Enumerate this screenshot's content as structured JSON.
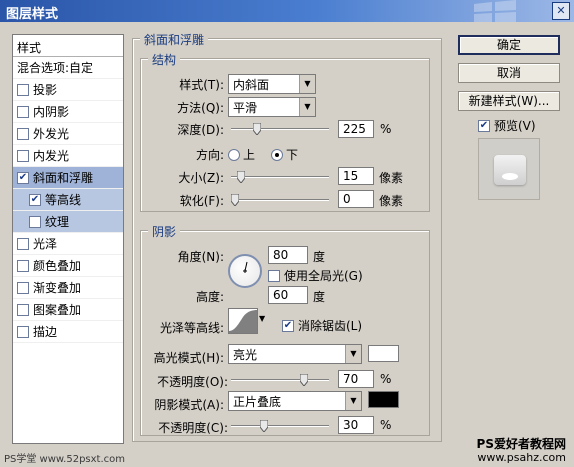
{
  "window": {
    "title": "图层样式",
    "close_label": "✕"
  },
  "style_list": {
    "header": "样式",
    "blending": "混合选项:自定",
    "items": [
      {
        "label": "投影",
        "checked": false
      },
      {
        "label": "内阴影",
        "checked": false
      },
      {
        "label": "外发光",
        "checked": false
      },
      {
        "label": "内发光",
        "checked": false
      },
      {
        "label": "斜面和浮雕",
        "checked": true
      },
      {
        "label": "等高线",
        "checked": true
      },
      {
        "label": "纹理",
        "checked": false
      },
      {
        "label": "光泽",
        "checked": false
      },
      {
        "label": "颜色叠加",
        "checked": false
      },
      {
        "label": "渐变叠加",
        "checked": false
      },
      {
        "label": "图案叠加",
        "checked": false
      },
      {
        "label": "描边",
        "checked": false
      }
    ]
  },
  "bevel": {
    "title": "斜面和浮雕",
    "structure": {
      "title": "结构",
      "style_label": "样式(T):",
      "style_value": "内斜面",
      "method_label": "方法(Q):",
      "method_value": "平滑",
      "depth_label": "深度(D):",
      "depth_value": "225",
      "depth_unit": "%",
      "depth_level": 0.22,
      "direction_label": "方向:",
      "direction_up": "上",
      "direction_down": "下",
      "size_label": "大小(Z):",
      "size_value": "15",
      "size_unit": "像素",
      "size_level": 0.06,
      "soften_label": "软化(F):",
      "soften_value": "0",
      "soften_unit": "像素",
      "soften_level": 0.0
    },
    "shading": {
      "title": "阴影",
      "angle_label": "角度(N):",
      "angle_value": "80",
      "angle_unit": "度",
      "global_light_label": "使用全局光(G)",
      "altitude_label": "高度:",
      "altitude_value": "60",
      "altitude_unit": "度",
      "gloss_label": "光泽等高线:",
      "antialias_label": "消除锯齿(L)",
      "highlight_mode_label": "高光模式(H):",
      "highlight_mode_value": "亮光",
      "highlight_color": "#ffffff",
      "highlight_opacity_label": "不透明度(O):",
      "highlight_opacity_value": "70",
      "highlight_opacity_level": 0.7,
      "shadow_mode_label": "阴影模式(A):",
      "shadow_mode_value": "正片叠底",
      "shadow_color": "#000000",
      "shadow_opacity_label": "不透明度(C):",
      "shadow_opacity_value": "30",
      "shadow_opacity_level": 0.3,
      "percent": "%"
    }
  },
  "buttons": {
    "ok": "确定",
    "cancel": "取消",
    "new_style": "新建样式(W)...",
    "preview": "预览(V)"
  },
  "watermarks": {
    "left": "PS学堂 www.52psxt.com",
    "right_title": "PS爱好者教程网",
    "right_url": "www.psahz.com"
  }
}
